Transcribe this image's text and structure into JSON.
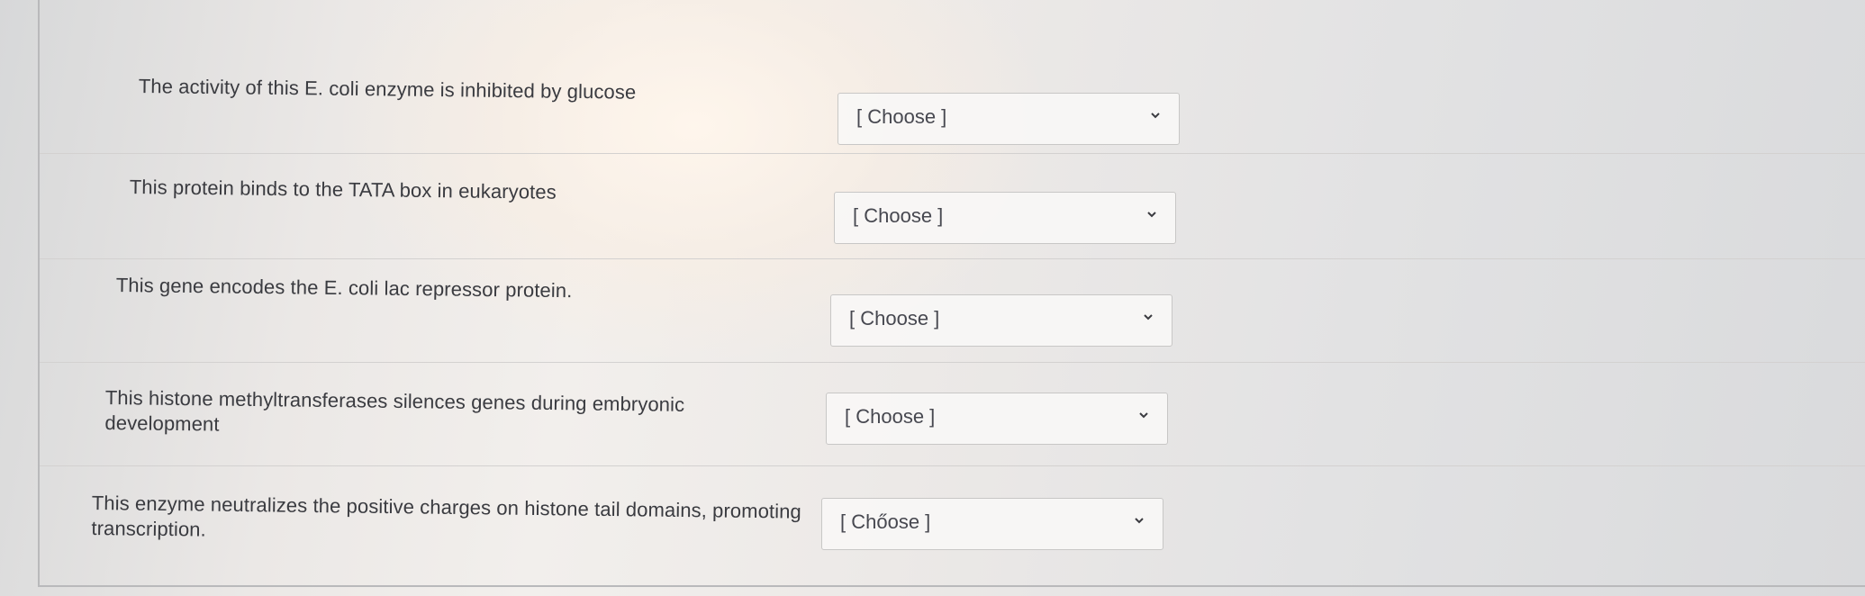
{
  "questions": [
    {
      "prompt": "The activity of this E. coli enzyme is inhibited by glucose",
      "selected": "[ Choose ]"
    },
    {
      "prompt": "This protein binds to the TATA box in eukaryotes",
      "selected": "[ Choose ]"
    },
    {
      "prompt": "This gene encodes the E. coli lac repressor protein.",
      "selected": "[ Choose ]"
    },
    {
      "prompt": "This histone methyltransferases silences genes during embryonic development",
      "selected": "[ Choose ]"
    },
    {
      "prompt": "This enzyme neutralizes the positive charges on histone tail domains, promoting transcription.",
      "selected": "[ Chőose ]"
    }
  ],
  "icons": {
    "dropdown": "chevron-down-icon"
  },
  "colors": {
    "text": "#3a3b40",
    "select_border": "#c8c7c6"
  }
}
